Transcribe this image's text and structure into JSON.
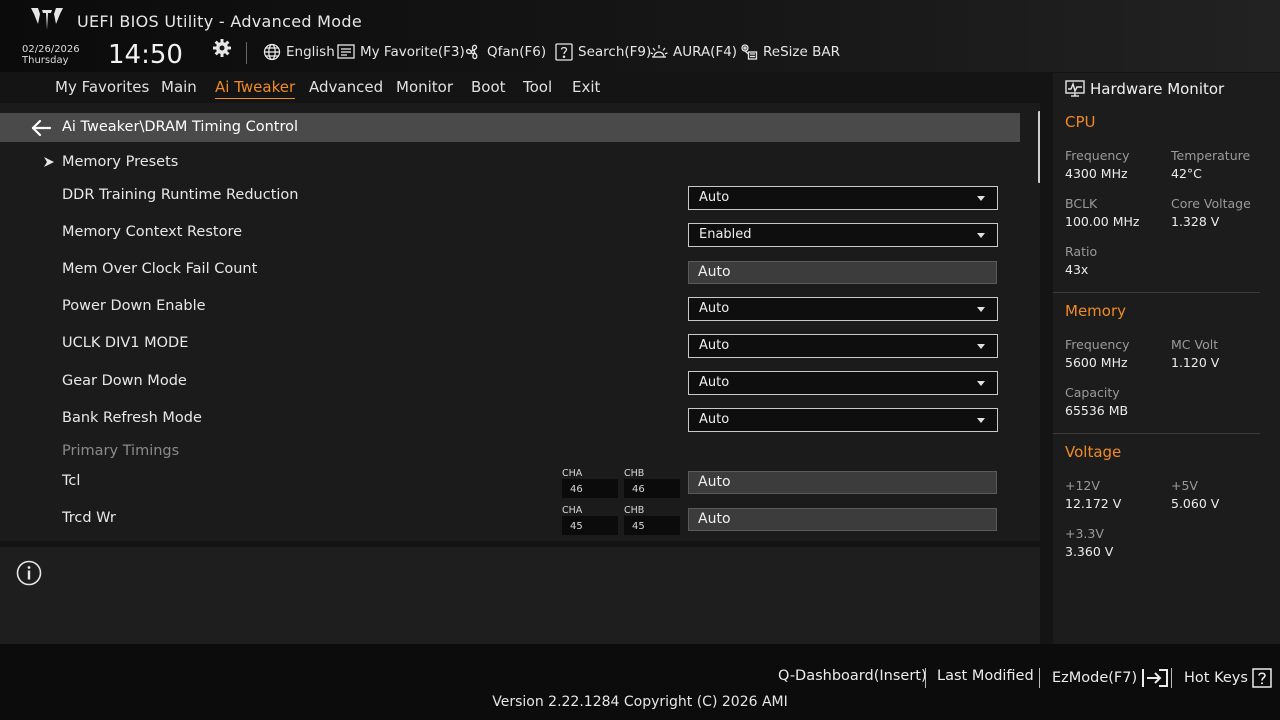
{
  "app": {
    "title": "UEFI BIOS Utility - Advanced Mode"
  },
  "status": {
    "date": "02/26/2026",
    "weekday": "Thursday",
    "time": "14:50"
  },
  "toolbar": {
    "language": "English",
    "favorite": "My Favorite(F3)",
    "qfan": "Qfan(F6)",
    "search": "Search(F9)",
    "aura": "AURA(F4)",
    "resize_bar": "ReSize BAR"
  },
  "menu": {
    "tabs": [
      "My Favorites",
      "Main",
      "Ai Tweaker",
      "Advanced",
      "Monitor",
      "Boot",
      "Tool",
      "Exit"
    ],
    "active": "Ai Tweaker"
  },
  "main": {
    "breadcrumb": "Ai Tweaker\\DRAM Timing Control",
    "submenu": "Memory Presets",
    "settings": [
      {
        "label": "DDR Training Runtime Reduction",
        "value": "Auto",
        "kind": "dropdown"
      },
      {
        "label": "Memory Context Restore",
        "value": "Enabled",
        "kind": "dropdown"
      },
      {
        "label": "Mem Over Clock Fail Count",
        "value": "Auto",
        "kind": "input"
      },
      {
        "label": "Power Down Enable",
        "value": "Auto",
        "kind": "dropdown"
      },
      {
        "label": "UCLK DIV1 MODE",
        "value": "Auto",
        "kind": "dropdown"
      },
      {
        "label": "Gear Down Mode",
        "value": "Auto",
        "kind": "dropdown"
      },
      {
        "label": "Bank Refresh Mode",
        "value": "Auto",
        "kind": "dropdown"
      }
    ],
    "section_header": "Primary Timings",
    "timings": [
      {
        "label": "Tcl",
        "cha_label": "CHA",
        "chb_label": "CHB",
        "cha": "46",
        "chb": "46",
        "value": "Auto"
      },
      {
        "label": "Trcd Wr",
        "cha_label": "CHA",
        "chb_label": "CHB",
        "cha": "45",
        "chb": "45",
        "value": "Auto"
      }
    ]
  },
  "hw": {
    "title": "Hardware Monitor",
    "cpu": {
      "title": "CPU",
      "freq_label": "Frequency",
      "freq": "4300 MHz",
      "temp_label": "Temperature",
      "temp": "42°C",
      "bclk_label": "BCLK",
      "bclk": "100.00 MHz",
      "vcore_label": "Core Voltage",
      "vcore": "1.328 V",
      "ratio_label": "Ratio",
      "ratio": "43x"
    },
    "memory": {
      "title": "Memory",
      "freq_label": "Frequency",
      "freq": "5600 MHz",
      "mcvolt_label": "MC Volt",
      "mcvolt": "1.120 V",
      "cap_label": "Capacity",
      "cap": "65536 MB"
    },
    "voltage": {
      "title": "Voltage",
      "v12_label": "+12V",
      "v12": "12.172 V",
      "v5_label": "+5V",
      "v5": "5.060 V",
      "v33_label": "+3.3V",
      "v33": "3.360 V"
    }
  },
  "footer": {
    "qdash": "Q-Dashboard(Insert)",
    "last_modified": "Last Modified",
    "ezmode": "EzMode(F7)",
    "hotkeys": "Hot Keys",
    "version": "Version 2.22.1284 Copyright (C) 2026 AMI"
  },
  "colors": {
    "accent": "#f08a24",
    "bg": "#141414",
    "panel": "#1b1b1b",
    "breadcrumb_bar": "#4a4a4a"
  },
  "icons": [
    "tuf-logo",
    "gear-icon",
    "globe-icon",
    "favorite-icon",
    "fan-icon",
    "search-icon",
    "aura-icon",
    "resize-bar-icon",
    "back-arrow-icon",
    "chevron-right-icon",
    "info-icon",
    "hardware-monitor-icon",
    "ezmode-exit-icon",
    "help-icon"
  ]
}
